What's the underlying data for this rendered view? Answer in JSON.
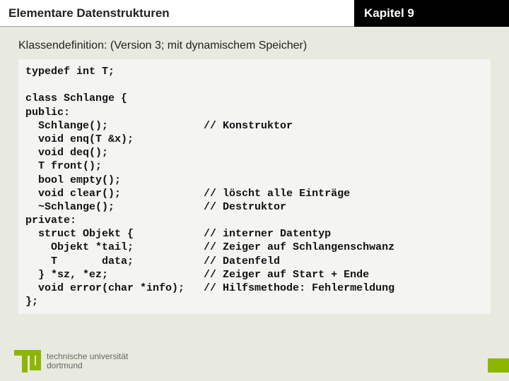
{
  "header": {
    "title_left": "Elementare Datenstrukturen",
    "title_right": "Kapitel 9"
  },
  "subtitle": "Klassendefinition: (Version 3; mit dynamischem Speicher)",
  "code": "typedef int T;\n\nclass Schlange {\npublic:\n  Schlange();               // Konstruktor\n  void enq(T &x);\n  void deq();\n  T front();\n  bool empty();\n  void clear();             // löscht alle Einträge\n  ~Schlange();              // Destruktor\nprivate:\n  struct Objekt {           // interner Datentyp\n    Objekt *tail;           // Zeiger auf Schlangenschwanz\n    T       data;           // Datenfeld\n  } *sz, *ez;               // Zeiger auf Start + Ende\n  void error(char *info);   // Hilfsmethode: Fehlermeldung\n};",
  "footer": {
    "org_line1": "technische universität",
    "org_line2": "dortmund"
  },
  "colors": {
    "accent": "#8db600",
    "bg": "#e8eadf",
    "codebg": "#f4f4f2"
  }
}
